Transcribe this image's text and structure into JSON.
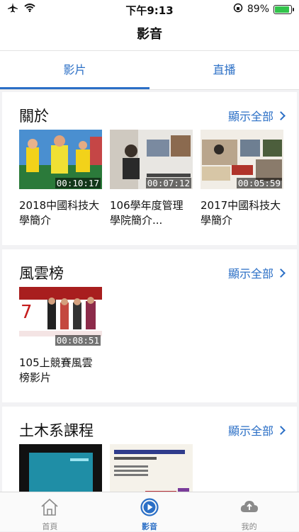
{
  "status": {
    "time": "下午9:13",
    "battery": "89%",
    "battery_level": 0.89
  },
  "nav": {
    "title": "影音"
  },
  "tabs": [
    {
      "label": "影片",
      "active": true
    },
    {
      "label": "直播",
      "active": false
    }
  ],
  "sections": [
    {
      "title": "關於",
      "show_all": "顯示全部",
      "videos": [
        {
          "title": "2018中國科技大學簡介",
          "duration": "00:10:17"
        },
        {
          "title": "106學年度管理學院簡介...",
          "duration": "00:07:12"
        },
        {
          "title": "2017中國科技大學簡介",
          "duration": "00:05:59"
        }
      ]
    },
    {
      "title": "風雲榜",
      "show_all": "顯示全部",
      "videos": [
        {
          "title": "105上競賽風雲榜影片",
          "duration": "00:08:51"
        }
      ]
    },
    {
      "title": "土木系課程",
      "show_all": "顯示全部",
      "videos": [
        {
          "title": "",
          "duration": ""
        },
        {
          "title": "",
          "duration": ""
        }
      ]
    }
  ],
  "bottom_nav": [
    {
      "label": "首頁",
      "icon": "home-icon"
    },
    {
      "label": "影音",
      "icon": "play-circle-icon",
      "active": true
    },
    {
      "label": "我的",
      "icon": "cloud-icon"
    }
  ],
  "colors": {
    "accent": "#2b6fc6",
    "battery": "#32c44b"
  }
}
